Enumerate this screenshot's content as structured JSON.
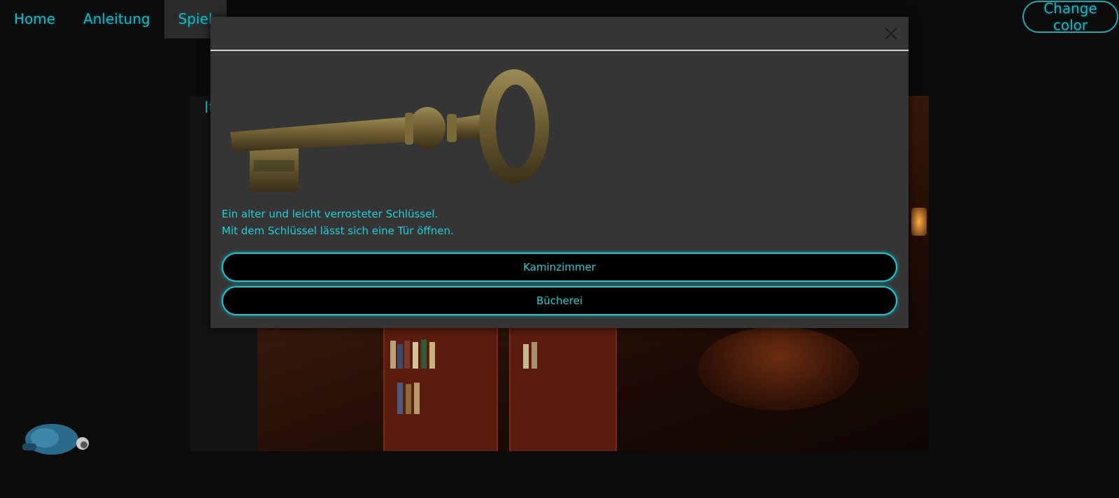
{
  "nav": {
    "items": [
      {
        "label": "Home"
      },
      {
        "label": "Anleitung"
      },
      {
        "label": "Spiel",
        "active": true
      }
    ]
  },
  "change_color_label": "Change color",
  "colors": {
    "accent": "#1ab6c4",
    "modal_bg": "#353535",
    "button_border": "#19c9d6"
  },
  "modal": {
    "close_icon": "close-icon",
    "image": "old-key",
    "description_lines": [
      "Ein alter und leicht verrosteter Schlüssel.",
      "Mit dem Schlüssel lässt sich eine Tür öffnen."
    ],
    "choices": [
      {
        "label": "Kaminzimmer"
      },
      {
        "label": "Bücherei"
      }
    ]
  },
  "game": {
    "panel_label": "It"
  }
}
